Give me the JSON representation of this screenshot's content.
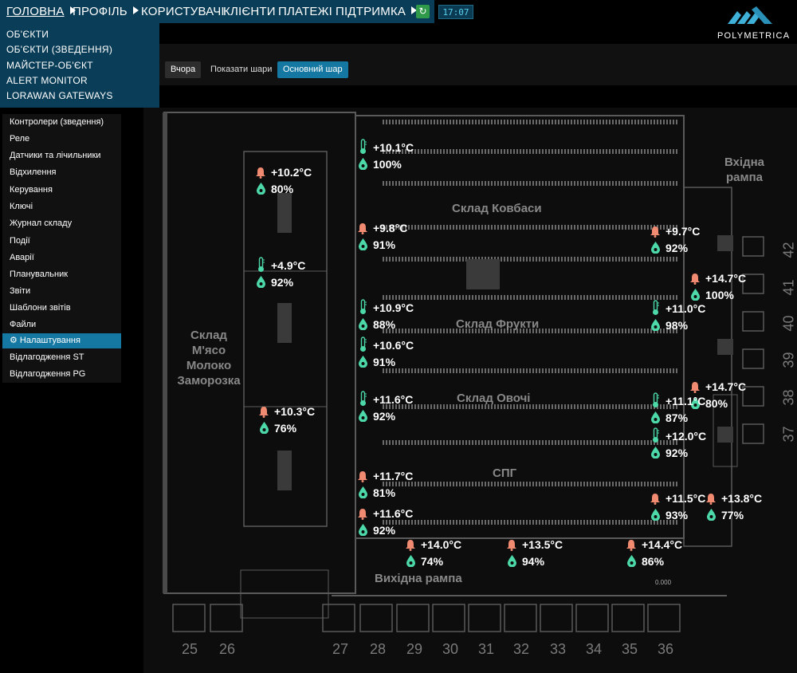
{
  "nav": {
    "items": [
      {
        "label": "ГОЛОВНА",
        "arrow": true
      },
      {
        "label": "ПРОФІЛЬ",
        "arrow": true
      },
      {
        "label": "КОРИСТУВАЧІ",
        "arrow": false
      },
      {
        "label": "КЛІЄНТИ",
        "arrow": false
      },
      {
        "label": "ПЛАТЕЖІ",
        "arrow": false
      },
      {
        "label": "ПІДТРИМКА",
        "arrow": true
      }
    ],
    "clock": "17:07"
  },
  "logo": {
    "text": "POLYMETRICA"
  },
  "dropdown": {
    "items": [
      "ОБ'ЄКТИ",
      "ОБ'ЄКТИ (ЗВЕДЕННЯ)",
      "МАЙСТЕР-ОБ'ЄКТ",
      "ALERT MONITOR",
      "LORAWAN GATEWAYS"
    ]
  },
  "toolbar": {
    "yesterday": "Вчора",
    "show_layers": "Показати шари",
    "main_layer": "Основний шар"
  },
  "sidebar": {
    "items": [
      "Контролери (зведення)",
      "Реле",
      "Датчики та лічильники",
      "Відхилення",
      "Керування",
      "Ключі",
      "Журнал складу",
      "Події",
      "Аварії",
      "Планувальник",
      "Звіти",
      "Шаблони звітів",
      "Файли",
      "Налаштування",
      "Відлагодження ST",
      "Відлагодження PG"
    ],
    "active_index": 13
  },
  "map": {
    "zones": {
      "kovbasy": "Склад Ковбаси",
      "frukty": "Склад Фрукти",
      "ovochi": "Склад Овочі",
      "spg": "СПГ",
      "exit_ramp": "Вихідна рампа",
      "entry_ramp_1": "Вхідна",
      "entry_ramp_2": "рампа",
      "meat_1": "Склад",
      "meat_2": "М'ясо",
      "meat_3": "Молоко",
      "meat_4": "Заморозка"
    },
    "dock_bottom": [
      "25",
      "26",
      "27",
      "28",
      "29",
      "30",
      "31",
      "32",
      "33",
      "34",
      "35",
      "36"
    ],
    "dock_right": [
      "42",
      "41",
      "40",
      "39",
      "38",
      "37"
    ],
    "sensors": [
      {
        "icon": "thermometer",
        "temp": "+10.1°C",
        "hum": "100%"
      },
      {
        "icon": "bell",
        "temp": "+10.2°C",
        "hum": "80%"
      },
      {
        "icon": "bell",
        "temp": "+9.8°C",
        "hum": "91%"
      },
      {
        "icon": "bell",
        "temp": "+9.7°C",
        "hum": "92%"
      },
      {
        "icon": "thermometer",
        "temp": "+4.9°C",
        "hum": "92%"
      },
      {
        "icon": "bell",
        "temp": "+14.7°C",
        "hum": "100%"
      },
      {
        "icon": "thermometer",
        "temp": "+10.9°C",
        "hum": "88%"
      },
      {
        "icon": "thermometer",
        "temp": "+11.0°C",
        "hum": "98%"
      },
      {
        "icon": "thermometer",
        "temp": "+10.6°C",
        "hum": "91%"
      },
      {
        "icon": "bell",
        "temp": "+14.7°C",
        "hum": "80%"
      },
      {
        "icon": "thermometer",
        "temp": "+11.6°C",
        "hum": "92%"
      },
      {
        "icon": "thermometer",
        "temp": "+11.1°C",
        "hum": "87%"
      },
      {
        "icon": "bell",
        "temp": "+10.3°C",
        "hum": "76%"
      },
      {
        "icon": "thermometer",
        "temp": "+12.0°C",
        "hum": "92%"
      },
      {
        "icon": "bell",
        "temp": "+11.7°C",
        "hum": "81%"
      },
      {
        "icon": "bell",
        "temp": "+11.5°C",
        "hum": "93%"
      },
      {
        "icon": "bell",
        "temp": "+13.8°C",
        "hum": "77%"
      },
      {
        "icon": "bell",
        "temp": "+11.6°C",
        "hum": "92%"
      },
      {
        "icon": "bell",
        "temp": "+14.0°C",
        "hum": "74%"
      },
      {
        "icon": "bell",
        "temp": "+13.5°C",
        "hum": "94%"
      },
      {
        "icon": "bell",
        "temp": "+14.4°C",
        "hum": "86%"
      }
    ],
    "small_labels": [
      "0.000"
    ]
  }
}
